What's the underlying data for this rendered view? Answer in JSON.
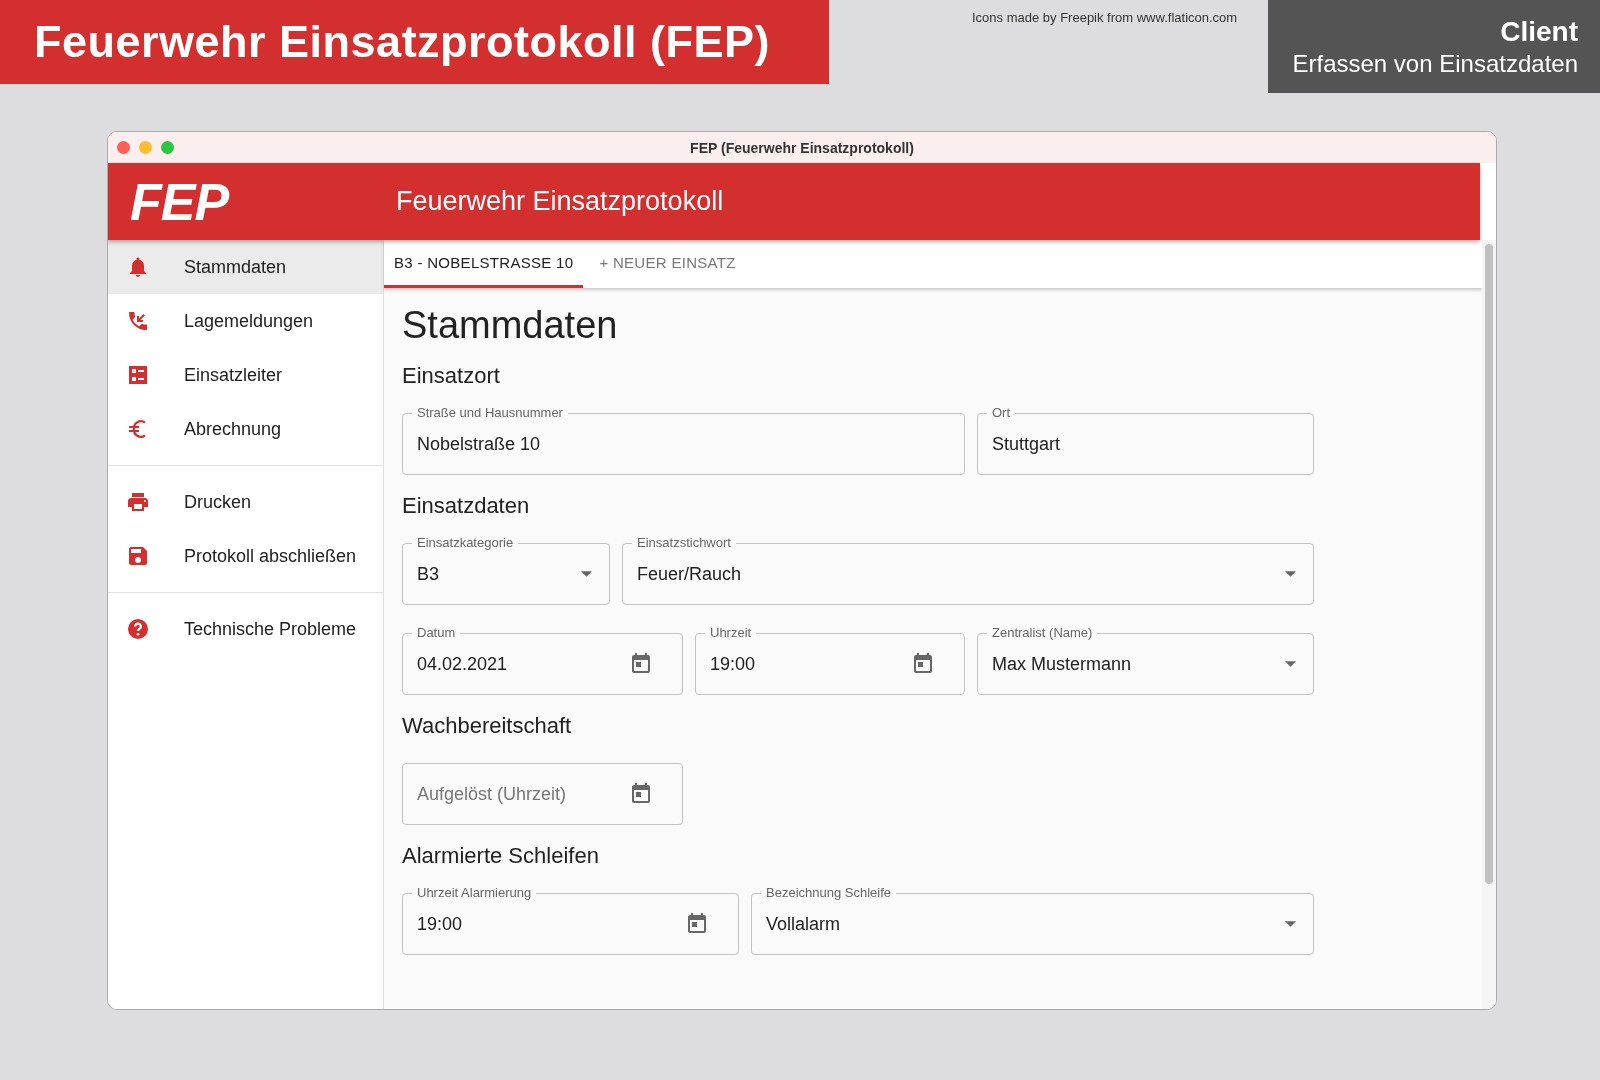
{
  "banner": {
    "title": "Feuerwehr Einsatzprotokoll (FEP)",
    "attribution": "Icons made by Freepik from www.flaticon.com",
    "client_title": "Client",
    "client_subtitle": "Erfassen von Einsatzdaten"
  },
  "window": {
    "title": "FEP (Feuerwehr Einsatzprotokoll)"
  },
  "header": {
    "logo": "FEP",
    "title": "Feuerwehr Einsatzprotokoll"
  },
  "sidebar": {
    "groups": [
      {
        "items": [
          {
            "label": "Stammdaten",
            "selected": true
          },
          {
            "label": "Lagemeldungen",
            "selected": false
          },
          {
            "label": "Einsatzleiter",
            "selected": false
          },
          {
            "label": "Abrechnung",
            "selected": false
          }
        ]
      },
      {
        "items": [
          {
            "label": "Drucken",
            "selected": false
          },
          {
            "label": "Protokoll abschließen",
            "selected": false
          }
        ]
      },
      {
        "items": [
          {
            "label": "Technische Probleme",
            "selected": false
          }
        ]
      }
    ]
  },
  "tabs": [
    {
      "label": "B3 - NOBELSTRASSE 10",
      "selected": true
    },
    {
      "label": "+ NEUER EINSATZ",
      "selected": false
    }
  ],
  "page_title": "Stammdaten",
  "sections": [
    {
      "heading": "Einsatzort",
      "rows": [
        [
          {
            "kind": "text",
            "label": "Straße und Hausnummer",
            "value": "Nobelstraße 10"
          },
          {
            "kind": "text",
            "label": "Ort",
            "value": "Stuttgart"
          }
        ]
      ]
    },
    {
      "heading": "Einsatzdaten",
      "rows": [
        [
          {
            "kind": "select",
            "label": "Einsatzkategorie",
            "value": "B3"
          },
          {
            "kind": "select",
            "label": "Einsatzstichwort",
            "value": "Feuer/Rauch"
          }
        ],
        [
          {
            "kind": "date",
            "label": "Datum",
            "value": "04.02.2021"
          },
          {
            "kind": "date",
            "label": "Uhrzeit",
            "value": "19:00"
          },
          {
            "kind": "select",
            "label": "Zentralist (Name)",
            "value": "Max Mustermann"
          }
        ]
      ]
    },
    {
      "heading": "Wachbereitschaft",
      "rows": [
        [
          {
            "kind": "date",
            "placeholder": "Aufgelöst (Uhrzeit)"
          }
        ]
      ]
    },
    {
      "heading": "Alarmierte Schleifen",
      "rows": [
        [
          {
            "kind": "date",
            "label": "Uhrzeit Alarmierung",
            "value": "19:00"
          },
          {
            "kind": "select",
            "label": "Bezeichnung Schleife",
            "value": "Vollalarm"
          }
        ]
      ]
    }
  ]
}
